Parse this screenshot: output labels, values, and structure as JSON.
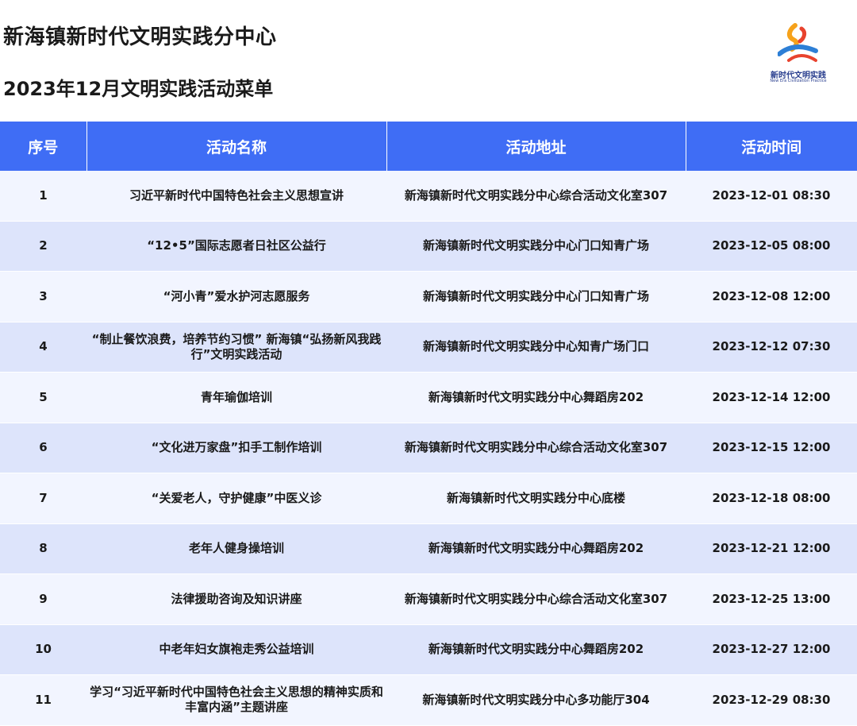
{
  "header": {
    "title": "新海镇新时代文明实践分中心",
    "subtitle": "2023年12月文明实践活动菜单"
  },
  "logo": {
    "text_cn": "新时代文明实践",
    "text_en": "New Era Civilization Practice"
  },
  "table": {
    "columns": [
      "序号",
      "活动名称",
      "活动地址",
      "活动时间"
    ],
    "rows": [
      {
        "no": "1",
        "name": "习近平新时代中国特色社会主义思想宣讲",
        "address": "新海镇新时代文明实践分中心综合活动文化室307",
        "time": "2023-12-01 08:30"
      },
      {
        "no": "2",
        "name": "“12•5”国际志愿者日社区公益行",
        "address": "新海镇新时代文明实践分中心门口知青广场",
        "time": "2023-12-05 08:00"
      },
      {
        "no": "3",
        "name": "“河小青”爱水护河志愿服务",
        "address": "新海镇新时代文明实践分中心门口知青广场",
        "time": "2023-12-08 12:00"
      },
      {
        "no": "4",
        "name": "“制止餐饮浪费，培养节约习惯” 新海镇“弘扬新风我践行”文明实践活动",
        "address": "新海镇新时代文明实践分中心知青广场门口",
        "time": "2023-12-12 07:30"
      },
      {
        "no": "5",
        "name": "青年瑜伽培训",
        "address": "新海镇新时代文明实践分中心舞蹈房202",
        "time": "2023-12-14 12:00"
      },
      {
        "no": "6",
        "name": "“文化进万家盘”扣手工制作培训",
        "address": "新海镇新时代文明实践分中心综合活动文化室307",
        "time": "2023-12-15 12:00"
      },
      {
        "no": "7",
        "name": "“关爱老人，守护健康”中医义诊",
        "address": "新海镇新时代文明实践分中心底楼",
        "time": "2023-12-18 08:00"
      },
      {
        "no": "8",
        "name": "老年人健身操培训",
        "address": "新海镇新时代文明实践分中心舞蹈房202",
        "time": "2023-12-21 12:00"
      },
      {
        "no": "9",
        "name": "法律援助咨询及知识讲座",
        "address": "新海镇新时代文明实践分中心综合活动文化室307",
        "time": "2023-12-25 13:00"
      },
      {
        "no": "10",
        "name": "中老年妇女旗袍走秀公益培训",
        "address": "新海镇新时代文明实践分中心舞蹈房202",
        "time": "2023-12-27 12:00"
      },
      {
        "no": "11",
        "name": "学习“习近平新时代中国特色社会主义思想的精神实质和丰富内涵”主题讲座",
        "address": "新海镇新时代文明实践分中心多功能厅304",
        "time": "2023-12-29 08:30"
      }
    ]
  },
  "colors": {
    "header_bg": "#3f6df5",
    "row_light": "#f2f5ff",
    "row_dark": "#dde4fb"
  }
}
